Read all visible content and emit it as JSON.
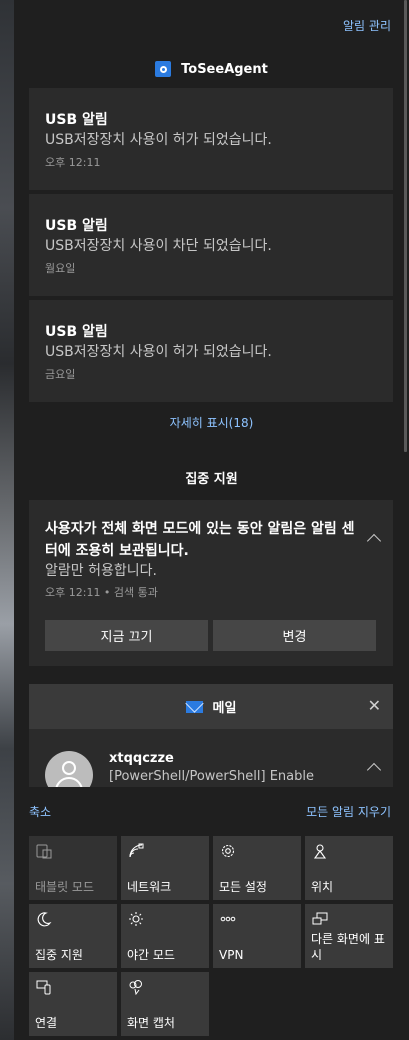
{
  "header": {
    "manage_label": "알림 관리",
    "app_name": "ToSeeAgent"
  },
  "notifications": [
    {
      "title": "USB 알림",
      "body": "USB저장장치 사용이 허가 되었습니다.",
      "time": "오후 12:11"
    },
    {
      "title": "USB 알림",
      "body": "USB저장장치 사용이 차단 되었습니다.",
      "time": "월요일"
    },
    {
      "title": "USB 알림",
      "body": "USB저장장치 사용이 허가 되었습니다.",
      "time": "금요일"
    }
  ],
  "more_label": "자세히 표시(18)",
  "focus": {
    "section_title": "집중 지원",
    "headline": "사용자가 전체 화면 모드에 있는 동안 알림은 알림 센터에 조용히 보관됩니다.",
    "subtext": "알람만 허용합니다.",
    "time": "오후 12:11 • 검색 통과",
    "turn_off_label": "지금 끄기",
    "change_label": "변경"
  },
  "mail": {
    "app_name": "메일",
    "sender": "xtqqczze",
    "preview": "[PowerShell/PowerShell] Enable"
  },
  "bottom": {
    "collapse_label": "축소",
    "clear_label": "모든 알림 지우기"
  },
  "quick_actions": [
    {
      "label": "태블릿 모드",
      "icon": "tablet-mode-icon",
      "enabled": false
    },
    {
      "label": "네트워크",
      "icon": "network-icon",
      "enabled": true
    },
    {
      "label": "모든 설정",
      "icon": "gear-icon",
      "enabled": true
    },
    {
      "label": "위치",
      "icon": "location-icon",
      "enabled": true
    },
    {
      "label": "집중 지원",
      "icon": "moon-icon",
      "enabled": true
    },
    {
      "label": "야간 모드",
      "icon": "sun-icon",
      "enabled": true
    },
    {
      "label": "VPN",
      "icon": "vpn-icon",
      "enabled": true
    },
    {
      "label": "다른 화면에 표시",
      "icon": "project-icon",
      "enabled": true
    },
    {
      "label": "연결",
      "icon": "connect-icon",
      "enabled": true
    },
    {
      "label": "화면 캡처",
      "icon": "screen-capture-icon",
      "enabled": true
    }
  ],
  "colors": {
    "accent_link": "#8ec3ff",
    "panel_bg": "#1f1f1f",
    "card_bg": "#2b2b2b",
    "tile_bg": "#3a3a3a"
  }
}
